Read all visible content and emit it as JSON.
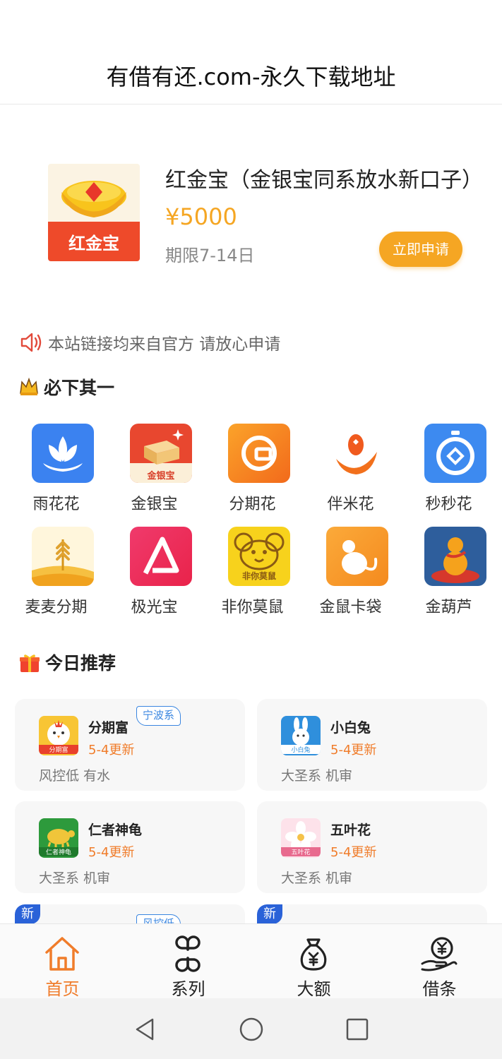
{
  "header": {
    "title": "有借有还.com-永久下载地址"
  },
  "feature": {
    "logo_text": "红金宝",
    "name": "红金宝（金银宝同系放水新口子）",
    "amount": "¥5000",
    "term": "期限7-14日",
    "apply_label": "立即申请"
  },
  "notice": {
    "text": "本站链接均来自官方 请放心申请"
  },
  "must_download": {
    "title": "必下其一",
    "apps": [
      {
        "name": "雨花花",
        "icon": "lotus-icon"
      },
      {
        "name": "金银宝",
        "icon": "gold-box-icon"
      },
      {
        "name": "分期花",
        "icon": "g-logo-icon"
      },
      {
        "name": "伴米花",
        "icon": "grain-hand-icon"
      },
      {
        "name": "秒秒花",
        "icon": "stopwatch-icon"
      },
      {
        "name": "麦麦分期",
        "icon": "wheat-icon"
      },
      {
        "name": "极光宝",
        "icon": "aurora-a-icon"
      },
      {
        "name": "非你莫鼠",
        "icon": "mouse-face-icon",
        "icon_text": "非你莫鼠"
      },
      {
        "name": "金鼠卡袋",
        "icon": "mouse-icon"
      },
      {
        "name": "金葫芦",
        "icon": "gourd-icon"
      }
    ]
  },
  "today_recommend": {
    "title": "今日推荐",
    "cards": [
      {
        "name": "分期富",
        "update": "5-4更新",
        "desc": "风控低 有水",
        "tag": "宁波系",
        "icon": "chick-icon",
        "icon_text": "分期富"
      },
      {
        "name": "小白兔",
        "update": "5-4更新",
        "desc": "大圣系 机审",
        "icon": "rabbit-icon",
        "icon_text": "小白兔"
      },
      {
        "name": "仁者神龟",
        "update": "5-4更新",
        "desc": "大圣系 机审",
        "icon": "turtle-icon",
        "icon_text": "仁者神龟"
      },
      {
        "name": "五叶花",
        "update": "5-4更新",
        "desc": "大圣系 机审",
        "icon": "flower-icon",
        "icon_text": "五叶花"
      }
    ],
    "partial_cards": [
      {
        "badge": "新",
        "tag": "风控低"
      },
      {
        "badge": "新"
      }
    ]
  },
  "bottom_nav": {
    "items": [
      {
        "label": "首页",
        "icon": "home-icon",
        "active": true
      },
      {
        "label": "系列",
        "icon": "grid-icon"
      },
      {
        "label": "大额",
        "icon": "money-bag-icon"
      },
      {
        "label": "借条",
        "icon": "yen-hand-icon"
      }
    ]
  },
  "colors": {
    "accent": "#f5a623",
    "update": "#f07c2a",
    "active_nav": "#f07c2a",
    "tag_blue": "#3a86e0"
  }
}
